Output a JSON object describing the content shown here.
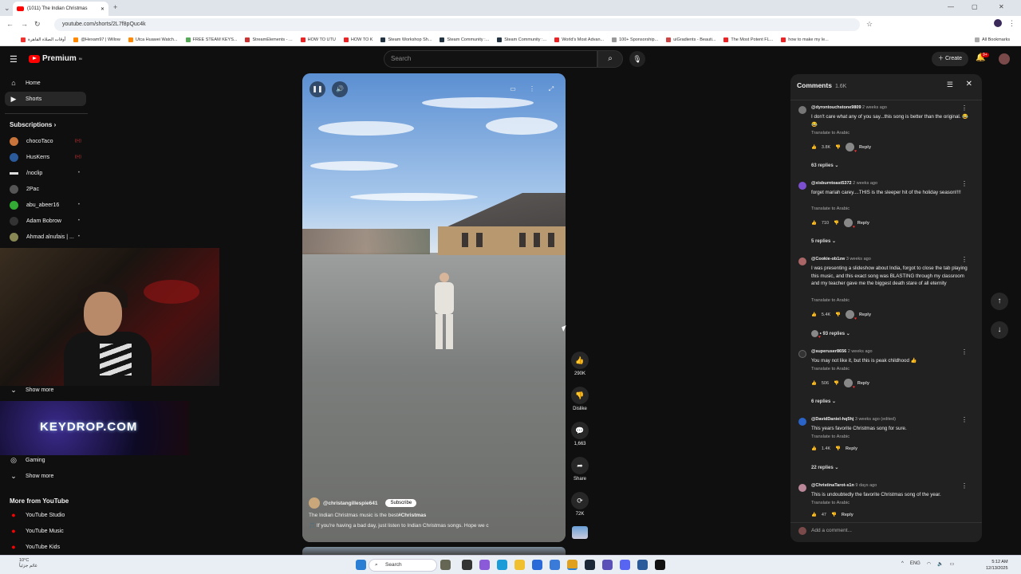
{
  "browser": {
    "tab_title": "(1011) The Indian Christmas",
    "new_tab": "+",
    "url": "youtube.com/shorts/2L7f8pQuc4k",
    "bookmarks": [
      {
        "label": "أوقات الصلاة القاهرة",
        "color": "#e33"
      },
      {
        "label": "@Hexam97 | Willow",
        "color": "#f80"
      },
      {
        "label": "Utca Huawei Watch...",
        "color": "#f80"
      },
      {
        "label": "FREE STEAM KEYS...",
        "color": "#5a5"
      },
      {
        "label": "StreamElements - ...",
        "color": "#c33"
      },
      {
        "label": "HOW TO UTU",
        "color": "#e22"
      },
      {
        "label": "HOW TO K",
        "color": "#e22"
      },
      {
        "label": "Steam Workshop Sh...",
        "color": "#234"
      },
      {
        "label": "Steam Community :...",
        "color": "#234"
      },
      {
        "label": "Steam Community :...",
        "color": "#234"
      },
      {
        "label": "World's Most Advan...",
        "color": "#e22"
      },
      {
        "label": "100+ Sponsorship...",
        "color": "#999"
      },
      {
        "label": "uiGradients - Beauti...",
        "color": "#c44"
      },
      {
        "label": "The Most Potent FL...",
        "color": "#e22"
      },
      {
        "label": "how to make my le...",
        "color": "#e22"
      }
    ],
    "all_bookmarks": "All Bookmarks"
  },
  "header": {
    "logo_text": "Premium",
    "logo_sup": "IN",
    "search_placeholder": "Search",
    "create_label": "Create",
    "notif_count": "9+"
  },
  "sidebar": {
    "home": "Home",
    "shorts": "Shorts",
    "subscriptions_title": "Subscriptions",
    "subscriptions": [
      {
        "name": "chocoTaco",
        "color": "#c8743a",
        "live": true
      },
      {
        "name": "HusKerrs",
        "color": "#2a5a9a",
        "live": true
      },
      {
        "name": "/noclip",
        "color": "#ddd",
        "live": false
      },
      {
        "name": "2Pac",
        "color": "#555",
        "live": false
      },
      {
        "name": "abu_abeer16",
        "color": "#3a3",
        "live": false
      },
      {
        "name": "Adam Bobrow",
        "color": "#333",
        "live": false
      },
      {
        "name": "Ahmad alnufais | ...",
        "color": "#885",
        "live": false
      }
    ],
    "show_more_1": "Show more",
    "gaming": "Gaming",
    "show_more_2": "Show more",
    "more_from_title": "More from YouTube",
    "more_from": [
      "YouTube Studio",
      "YouTube Music",
      "YouTube Kids"
    ],
    "promo_text": "KEYDROP.COM"
  },
  "video": {
    "channel": "@christangillespie641",
    "subscribe": "Subscribe",
    "title": "The Indian Christmas music is the best",
    "hashtag": "#Christmas",
    "desc": "🎵 If you're having a bad day, just listen to Indian Christmas songs. Hope we c"
  },
  "actions": {
    "likes": "290K",
    "dislike": "Dislike",
    "comments": "1,663",
    "share": "Share",
    "remix": "72K"
  },
  "comments": {
    "title": "Comments",
    "count": "1.6K",
    "translate": "Translate to Arabic",
    "reply": "Reply",
    "add_placeholder": "Add a comment...",
    "items": [
      {
        "user": "@dyrontouchstone9809",
        "time": "2 weeks ago",
        "text": "I don't care what any of you say...this song is better than the original. 😂😂",
        "likes": "3.8K",
        "replies": "63 replies",
        "color": "#777"
      },
      {
        "user": "@xisburntoast5372",
        "time": "2 weeks ago",
        "text": "forget mariah carey....THIS is the sleeper hit of the holiday season!!!!",
        "likes": "710",
        "replies": "5 replies",
        "color": "#7b4fd0"
      },
      {
        "user": "@Cookie-ob1zw",
        "time": "3 weeks ago",
        "text": "I was presenting a slideshow about India, forgot to close the tab playing this music, and this exact song was BLASTING through my classroom and my teacher gave me the biggest death stare of all eternity",
        "likes": "5.4K",
        "replies": "93 replies",
        "color": "#a66"
      },
      {
        "user": "@superuser8656",
        "time": "2 weeks ago",
        "text": "You may not like it, but this is peak childhood 👍",
        "likes": "506",
        "replies": "6 replies",
        "color": "#333"
      },
      {
        "user": "@DavidDaniel-hq5hj",
        "time": "3 weeks ago (edited)",
        "text": "This years favorite Christmas song for sure.",
        "likes": "1.4K",
        "replies": "22 replies",
        "color": "#2a64c8"
      },
      {
        "user": "@ChristinaTarot-s1n",
        "time": "9 days ago",
        "text": "This is undoubtedly the favorite Christmas song of the year.",
        "likes": "47",
        "replies": "",
        "color": "#b89"
      }
    ]
  },
  "taskbar": {
    "temp": "10°C",
    "weather": "غائم جزئياً",
    "search": "Search",
    "lang": "ENG",
    "time": "5:12 AM",
    "date": "12/13/2025"
  }
}
